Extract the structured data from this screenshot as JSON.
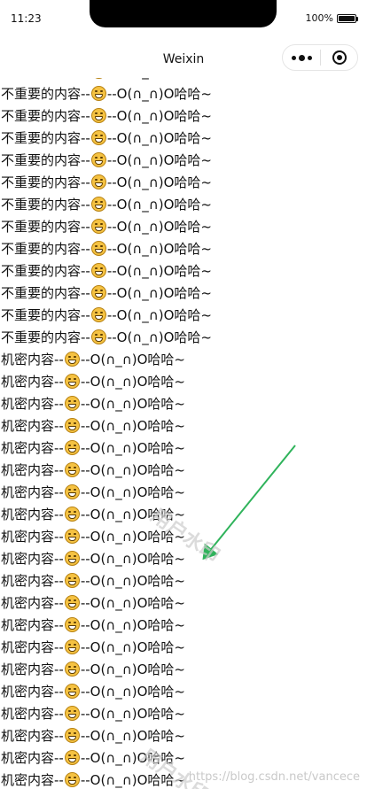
{
  "status_bar": {
    "time": "11:23",
    "battery": "100%"
  },
  "nav": {
    "title": "Weixin"
  },
  "lines": {
    "unimportant": {
      "prefix": "不重要的内容--",
      "suffix": "--O(∩_∩)O哈哈~",
      "count": 13
    },
    "secret": {
      "prefix": "机密内容--",
      "suffix": "--O(∩_∩)O哈哈~",
      "count": 20
    }
  },
  "watermark": {
    "stamp_text": "用户水印",
    "url": "https://blog.csdn.net/vancece"
  },
  "colors": {
    "arrow": "#2fb35b",
    "watermark": "#cccccc"
  },
  "icons": {
    "emoji": "grinning-face-icon",
    "menu": "more-dots-icon",
    "close": "target-circle-icon"
  }
}
